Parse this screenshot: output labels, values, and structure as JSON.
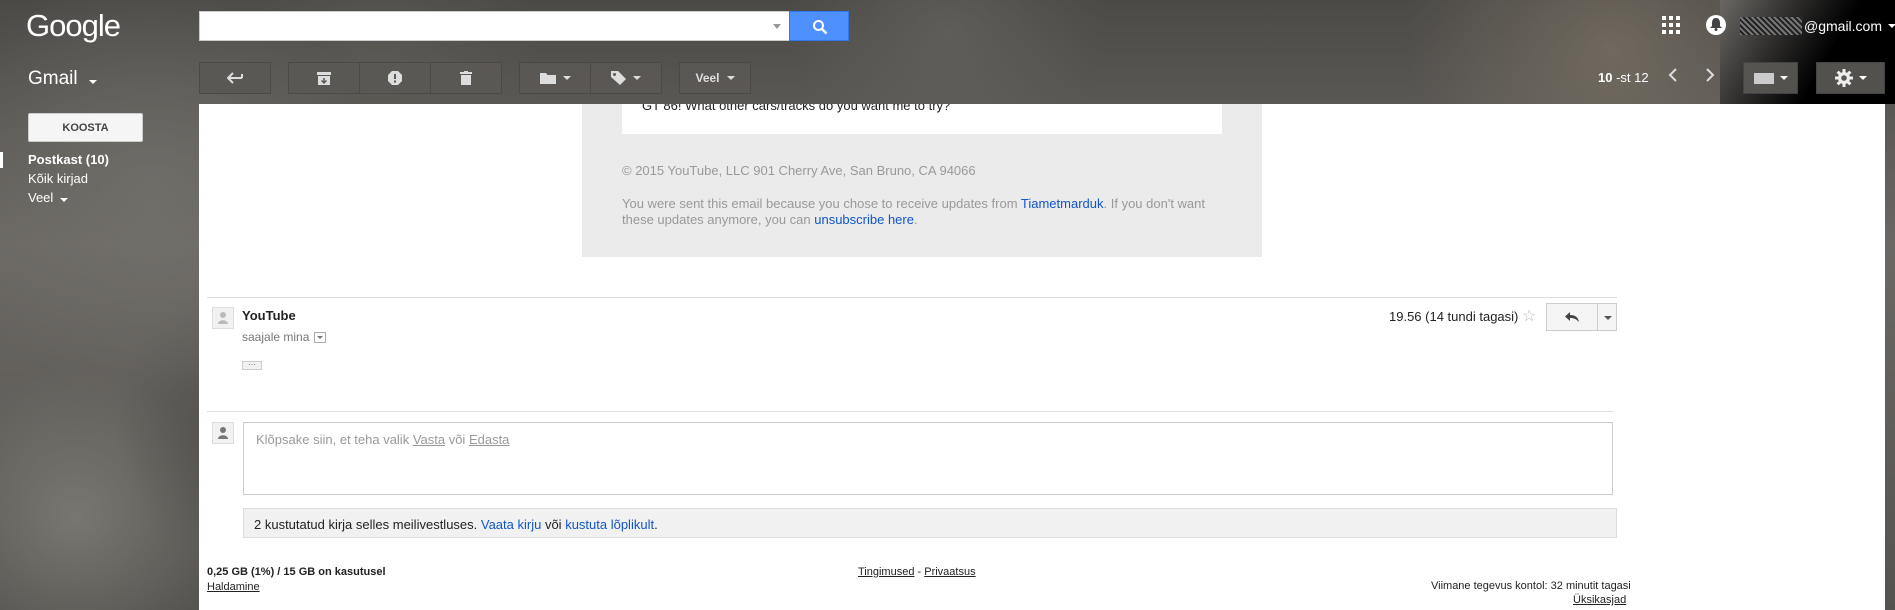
{
  "header": {
    "logo": "Google",
    "account_suffix": "@gmail.com",
    "search_placeholder": ""
  },
  "toolbar": {
    "gmail_label": "Gmail",
    "more_label": "Veel",
    "pager_range": "10",
    "pager_of": "-st 12"
  },
  "nav": {
    "compose_label": "KOOSTA",
    "items": [
      {
        "label": "Postkast (10)",
        "active": true
      },
      {
        "label": "Kõik kirjad",
        "active": false
      },
      {
        "label": "Veel",
        "active": false
      }
    ]
  },
  "message_prev": {
    "cut_text": "GT 86! What other cars/tracks do you want me to try?",
    "copyright": "© 2015 YouTube, LLC 901 Cherry Ave, San Bruno, CA 94066",
    "note_prefix": "You were sent this email because you chose to receive updates from ",
    "note_channel": "Tiametmarduk",
    "note_middle": ". If you don't want these updates anymore, you can ",
    "note_unsub": "unsubscribe here",
    "note_end": "."
  },
  "message": {
    "sender": "YouTube",
    "to": "saajale mina",
    "date": "19.56 (14 tundi tagasi)",
    "ellipsis": "···"
  },
  "reply": {
    "prompt_prefix": "Klõpsake siin, et teha valik ",
    "reply_link": "Vasta",
    "or": " või ",
    "forward_link": "Edasta"
  },
  "deleted": {
    "text": "2 kustutatud kirja selles meilivestluses. ",
    "view_link": "Vaata kirju",
    "or": " või ",
    "delete_link": "kustuta lõplikult",
    "end": "."
  },
  "footer": {
    "storage": "0,25 GB (1%) / 15 GB on kasutusel",
    "manage": "Haldamine",
    "terms": "Tingimused",
    "sep": " - ",
    "privacy": "Privaatsus",
    "activity": "Viimane tegevus kontol: 32 minutit tagasi",
    "details": "Üksikasjad"
  },
  "colors": {
    "accent_blue": "#4d90fe",
    "link_blue": "#1155cc"
  }
}
